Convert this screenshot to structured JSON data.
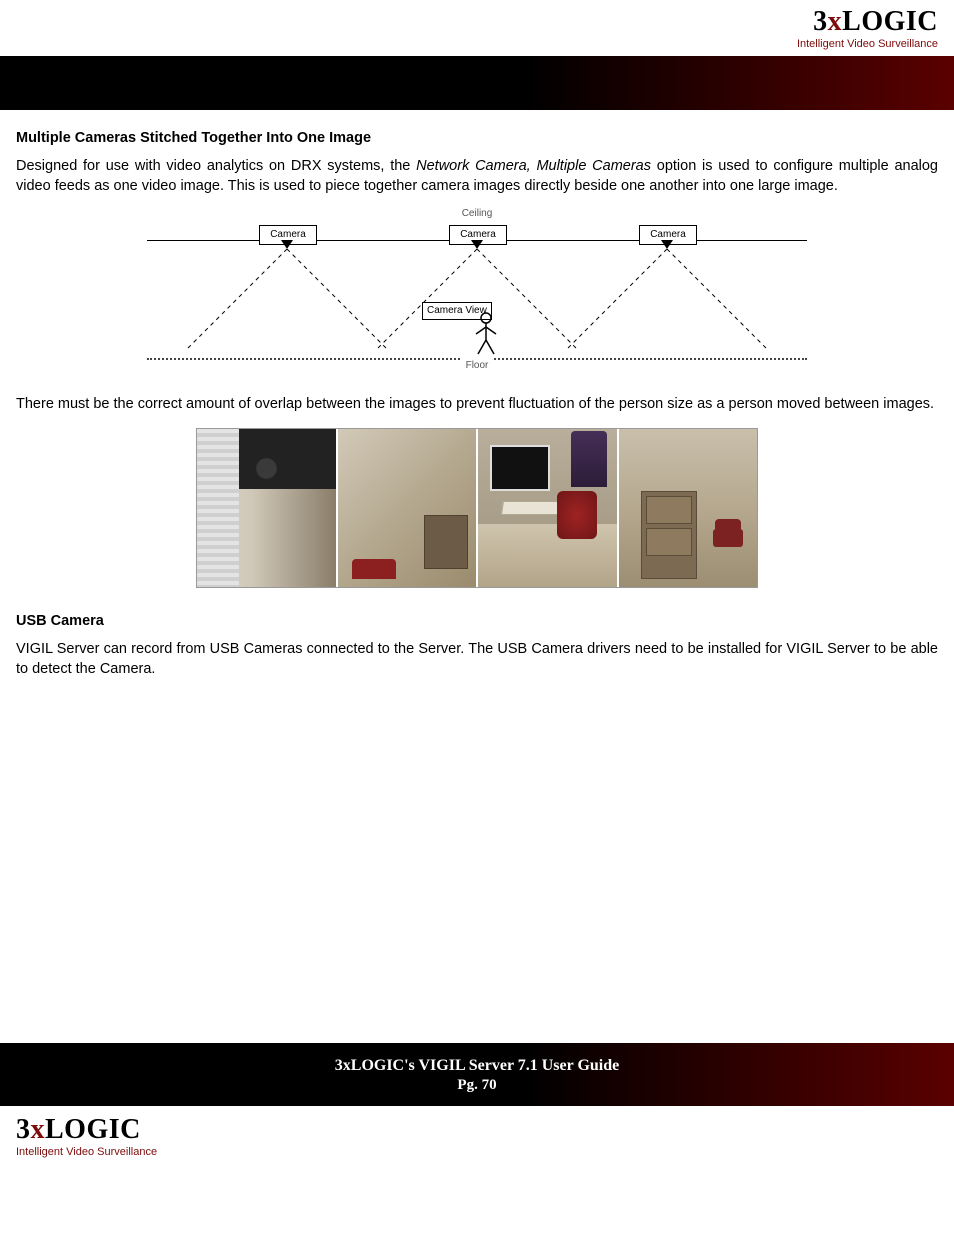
{
  "logo": {
    "part_a": "3",
    "part_b": "x",
    "part_c": "LOGIC",
    "tagline": "Intelligent Video Surveillance"
  },
  "section1": {
    "heading": "Multiple Cameras Stitched Together Into One Image",
    "para1_a": "Designed for use with video analytics on DRX systems, the ",
    "para1_ital": "Network Camera, Multiple Cameras",
    "para1_b": " option is used to configure multiple analog video feeds as one video image.  This is used to piece together camera images directly beside one another into one large image.",
    "para2": "There must be the correct amount of overlap between the images to prevent fluctuation of the person size as a person moved between images."
  },
  "diagram": {
    "ceiling": "Ceiling",
    "floor": "Floor",
    "camera": "Camera",
    "camera_view": "Camera View"
  },
  "section2": {
    "heading": "USB Camera",
    "para": "VIGIL Server can record from USB Cameras connected to the Server.  The USB Camera drivers need to be installed for VIGIL Server to be able to detect the Camera."
  },
  "footer": {
    "title": "3xLOGIC's VIGIL Server 7.1 User Guide",
    "page": "Pg. 70"
  }
}
